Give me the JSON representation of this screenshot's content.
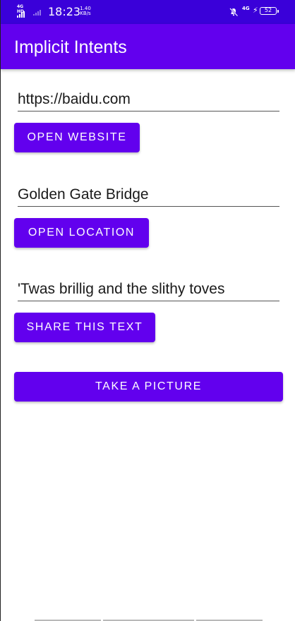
{
  "status_bar": {
    "network_type": "4G HD",
    "time": "18:23",
    "speed_value": "1.40",
    "speed_unit": "KB/s",
    "mobile_data": "4G",
    "battery_level": "52",
    "background_color": "#3a00d9"
  },
  "app_bar": {
    "title": "Implicit Intents",
    "color": "#6200ee"
  },
  "website": {
    "input_value": "https://baidu.com",
    "button_label": "OPEN WEBSITE"
  },
  "location": {
    "input_value": "Golden Gate Bridge",
    "button_label": "OPEN LOCATION"
  },
  "share": {
    "input_value": "'Twas brillig and the slithy toves",
    "button_label": "SHARE THIS TEXT"
  },
  "camera": {
    "button_label": "TAKE A PICTURE"
  },
  "colors": {
    "accent": "#6200ee",
    "status_bar": "#3a00d9",
    "background": "#ffffff"
  }
}
